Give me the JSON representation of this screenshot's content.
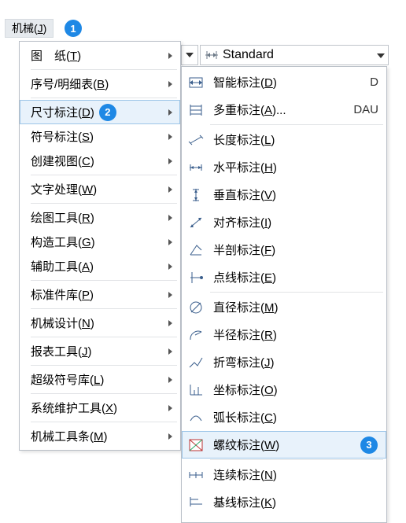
{
  "menu_button": {
    "label_pre": "机械(",
    "hotkey": "J",
    "label_post": ")"
  },
  "badges": {
    "b1": "1",
    "b2": "2",
    "b3": "3"
  },
  "combo": {
    "standard": "Standard"
  },
  "menu1": {
    "items": [
      {
        "pre": "图　纸(",
        "hk": "T",
        "post": ")"
      },
      {
        "pre": "序号/明细表(",
        "hk": "B",
        "post": ")"
      },
      {
        "pre": "尺寸标注(",
        "hk": "D",
        "post": ")"
      },
      {
        "pre": "符号标注(",
        "hk": "S",
        "post": ")"
      },
      {
        "pre": "创建视图(",
        "hk": "C",
        "post": ")"
      },
      {
        "pre": "文字处理(",
        "hk": "W",
        "post": ")"
      },
      {
        "pre": "绘图工具(",
        "hk": "R",
        "post": ")"
      },
      {
        "pre": "构造工具(",
        "hk": "G",
        "post": ")"
      },
      {
        "pre": "辅助工具(",
        "hk": "A",
        "post": ")"
      },
      {
        "pre": "标准件库(",
        "hk": "P",
        "post": ")"
      },
      {
        "pre": "机械设计(",
        "hk": "N",
        "post": ")"
      },
      {
        "pre": "报表工具(",
        "hk": "J",
        "post": ")"
      },
      {
        "pre": "超级符号库(",
        "hk": "L",
        "post": ")"
      },
      {
        "pre": "系统维护工具(",
        "hk": "X",
        "post": ")"
      },
      {
        "pre": "机械工具条(",
        "hk": "M",
        "post": ")"
      }
    ]
  },
  "menu2": {
    "items": [
      {
        "pre": "智能标注(",
        "hk": "D",
        "post": ")",
        "shc": "D"
      },
      {
        "pre": "多重标注(",
        "hk": "A",
        "post": ")...",
        "shc": "DAU"
      },
      {
        "pre": "长度标注(",
        "hk": "L",
        "post": ")"
      },
      {
        "pre": "水平标注(",
        "hk": "H",
        "post": ")"
      },
      {
        "pre": "垂直标注(",
        "hk": "V",
        "post": ")"
      },
      {
        "pre": "对齐标注(",
        "hk": "I",
        "post": ")"
      },
      {
        "pre": "半剖标注(",
        "hk": "F",
        "post": ")"
      },
      {
        "pre": "点线标注(",
        "hk": "E",
        "post": ")"
      },
      {
        "pre": "直径标注(",
        "hk": "M",
        "post": ")"
      },
      {
        "pre": "半径标注(",
        "hk": "R",
        "post": ")"
      },
      {
        "pre": "折弯标注(",
        "hk": "J",
        "post": ")"
      },
      {
        "pre": "坐标标注(",
        "hk": "O",
        "post": ")"
      },
      {
        "pre": "弧长标注(",
        "hk": "C",
        "post": ")"
      },
      {
        "pre": "螺纹标注(",
        "hk": "W",
        "post": ")"
      },
      {
        "pre": "连续标注(",
        "hk": "N",
        "post": ")"
      },
      {
        "pre": "基线标注(",
        "hk": "K",
        "post": ")"
      }
    ]
  }
}
